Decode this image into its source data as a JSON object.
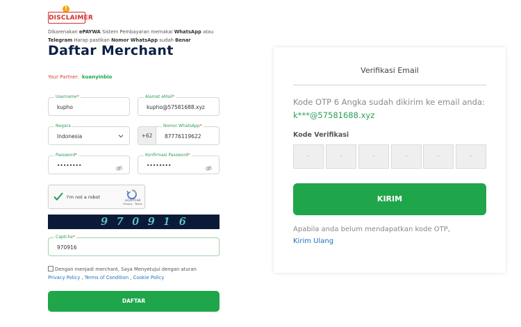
{
  "disclaimer": {
    "badge": "DISCLAIMER",
    "mark": "!",
    "line1_prefix": "Dikarenakan ",
    "line1_brand": "ePAYWA",
    "line1_mid": " Sistem Pembayaran memakai ",
    "line1_app": "WhatsApp",
    "line1_suffix": " atau",
    "line2_app": "Telegram",
    "line2_mid": " Harap pastikan ",
    "line2_field": "Nomor WhatsApp",
    "line2_mid2": " sudah ",
    "line2_end": "Benar"
  },
  "page_title": "Daftar Merchant",
  "partner": {
    "label": "Your Partner:",
    "value": "kuanyinbio"
  },
  "form": {
    "username": {
      "label": "Username",
      "value": "kupho"
    },
    "email": {
      "label": "Alamat eMail",
      "value": "kupho@57581688.xyz"
    },
    "country": {
      "label": "Negara",
      "value": "Indonesia"
    },
    "whatsapp": {
      "label": "Nomor WhatsApp",
      "prefix": "+62",
      "value": "87776119622"
    },
    "password": {
      "label": "Password",
      "value": "••••••••"
    },
    "confirm_password": {
      "label": "Konfirmasi Password",
      "value": "••••••••"
    },
    "captcha": {
      "label": "Captcha",
      "value": "970916"
    },
    "required_mark": "*"
  },
  "recaptcha": {
    "text": "I'm not a robot",
    "brand": "reCAPTCHA",
    "links": "Privacy - Terms"
  },
  "captcha_image_code": "970916",
  "terms": {
    "text": "Dengan menjadi merchant, Saya Menyetujui dengan aturan",
    "privacy": "Privacy Policy",
    "sep1": " , ",
    "tos": "Terms of Condition",
    "sep2": " , ",
    "cookie": "Cookie Policy"
  },
  "register_button": "DAFTAR",
  "verify": {
    "title": "Verifikasi Email",
    "otp_message": "Kode OTP 6 Angka sudah dikirim ke email anda:",
    "otp_email": "k***@57581688.xyz",
    "code_label": "Kode Verifikasi",
    "otp_placeholders": [
      "-",
      "-",
      "-",
      "-",
      "-",
      "-"
    ],
    "submit": "KIRIM",
    "resend_message": "Apabila anda belum mendapatkan kode OTP,",
    "resend_link": "Kirim Ulang"
  },
  "colors": {
    "primary_green": "#1fa64a",
    "navy": "#0d2145",
    "link_blue": "#1f6fbf",
    "danger_red": "#e23b3b"
  }
}
